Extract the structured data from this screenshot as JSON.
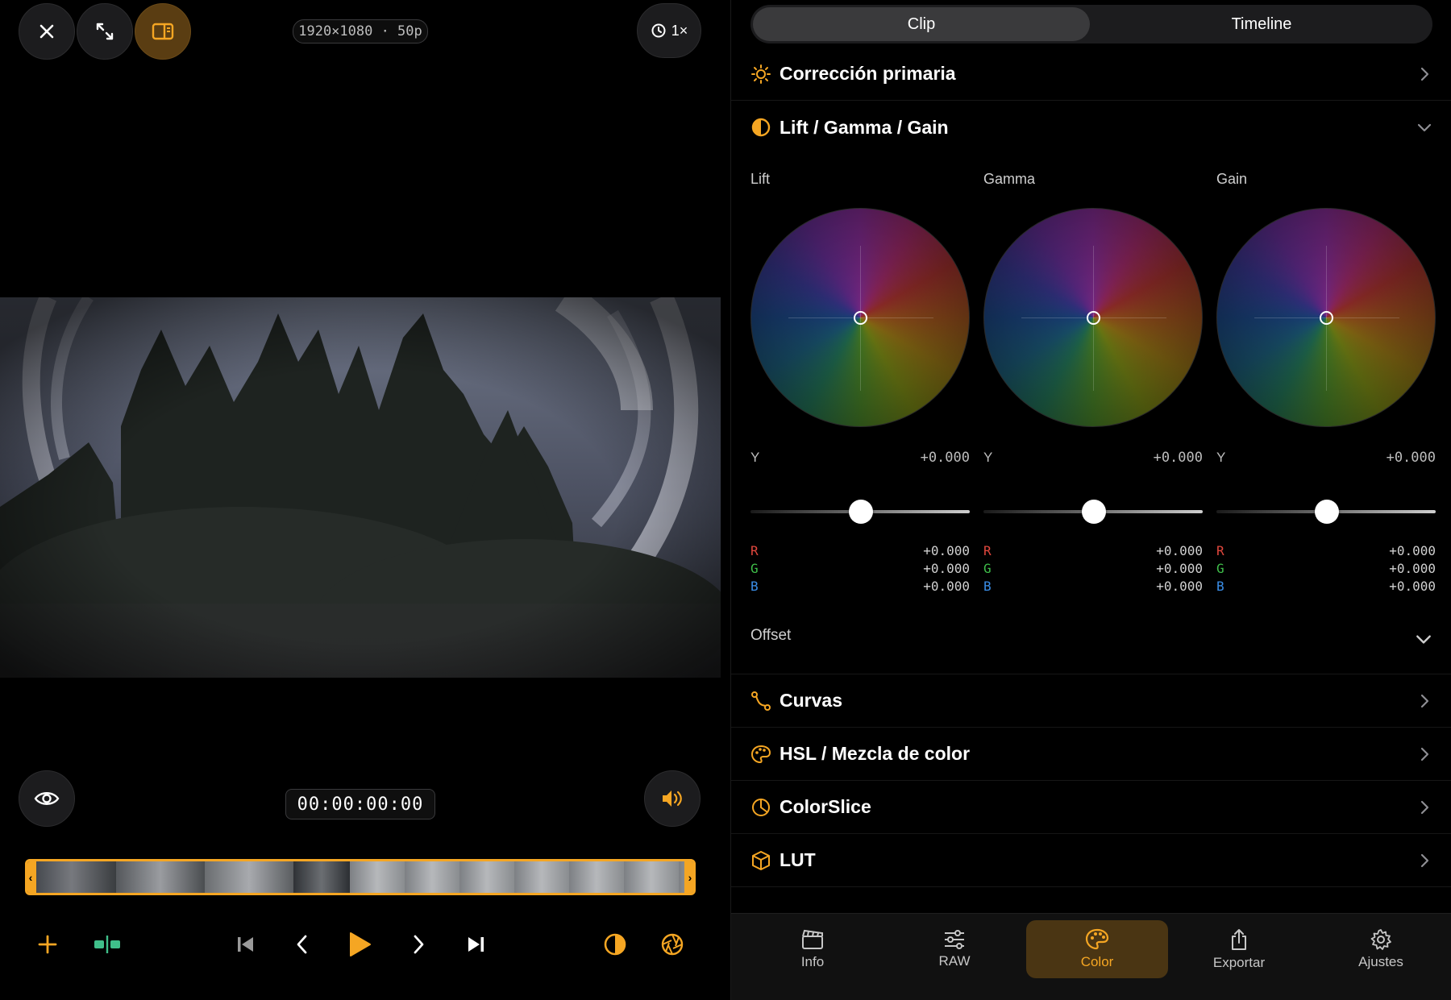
{
  "viewer": {
    "format_badge": "1920×1080 · 50p",
    "speed_label": "1×",
    "timecode": "00:00:00:00"
  },
  "inspector": {
    "tabs": [
      {
        "label": "Clip",
        "selected": true
      },
      {
        "label": "Timeline",
        "selected": false
      }
    ],
    "sections": {
      "primary": "Corrección primaria",
      "lgg": "Lift / Gamma / Gain",
      "curves": "Curvas",
      "hsl": "HSL / Mezcla de color",
      "colorslice": "ColorSlice",
      "lut": "LUT"
    },
    "wheels": [
      {
        "title": "Lift",
        "y_label": "Y",
        "y_value": "+0.000",
        "r": "+0.000",
        "g": "+0.000",
        "b": "+0.000"
      },
      {
        "title": "Gamma",
        "y_label": "Y",
        "y_value": "+0.000",
        "r": "+0.000",
        "g": "+0.000",
        "b": "+0.000"
      },
      {
        "title": "Gain",
        "y_label": "Y",
        "y_value": "+0.000",
        "r": "+0.000",
        "g": "+0.000",
        "b": "+0.000"
      }
    ],
    "channel_labels": {
      "r": "R",
      "g": "G",
      "b": "B"
    },
    "offset_label": "Offset"
  },
  "tabbar": [
    {
      "label": "Info",
      "icon": "clapperboard-icon",
      "active": false
    },
    {
      "label": "RAW",
      "icon": "sliders-icon",
      "active": false
    },
    {
      "label": "Color",
      "icon": "palette-icon",
      "active": true
    },
    {
      "label": "Exportar",
      "icon": "share-icon",
      "active": false
    },
    {
      "label": "Ajustes",
      "icon": "gear-icon",
      "active": false
    }
  ],
  "colors": {
    "accent": "#f5a623",
    "r": "#e0473d",
    "g": "#3fbf4a",
    "b": "#3a8ee8"
  }
}
